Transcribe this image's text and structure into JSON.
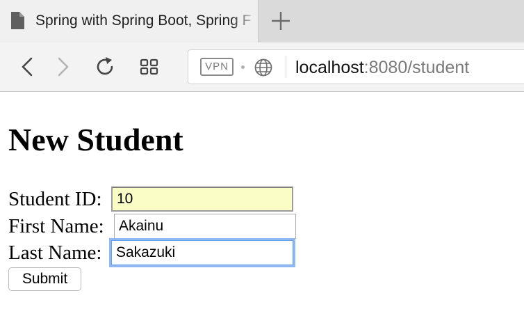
{
  "browser": {
    "tab": {
      "title": "Spring with Spring Boot, Spring Framework"
    },
    "toolbar": {
      "vpn_label": "VPN",
      "url_host": "localhost",
      "url_rest": ":8080/student"
    },
    "icons": {
      "favicon": "document-icon",
      "new_tab": "plus-icon",
      "back": "chevron-left-icon",
      "forward": "chevron-right-icon",
      "reload": "reload-icon",
      "tabs_overview": "grid-icon",
      "site_info": "globe-icon"
    }
  },
  "page": {
    "title": "New Student",
    "form": {
      "student_id": {
        "label": "Student ID:",
        "value": "10"
      },
      "first_name": {
        "label": "First Name:",
        "value": "Akainu"
      },
      "last_name": {
        "label": "Last Name:",
        "value": "Sakazuki"
      },
      "submit_label": "Submit"
    }
  },
  "colors": {
    "autofill_background": "#fbfdc6",
    "focus_ring": "#8fb7f0"
  }
}
